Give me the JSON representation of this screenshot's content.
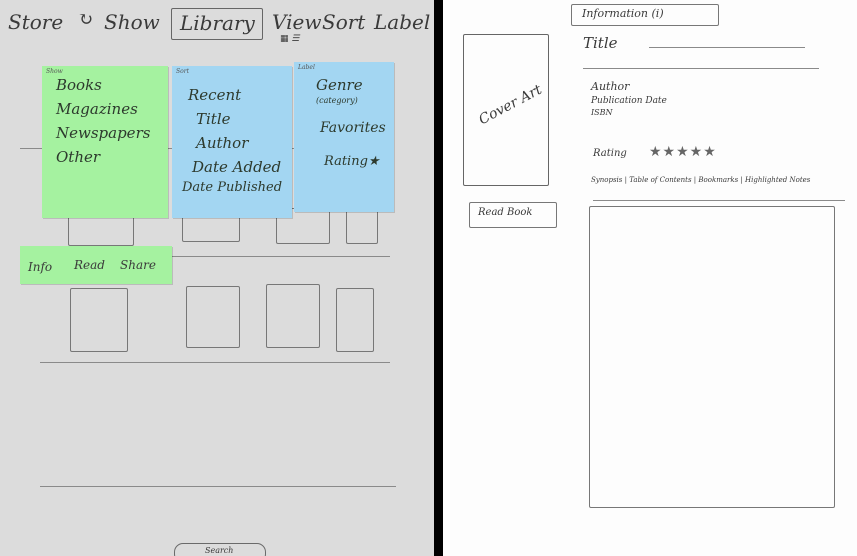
{
  "nav": {
    "store": "Store",
    "sync": "↻",
    "show": "Show",
    "library": "Library",
    "view": "View",
    "view_sub": "▦ ☰",
    "sort": "Sort",
    "label": "Label"
  },
  "show_menu": {
    "tab": "Show",
    "items": [
      "Books",
      "Magazines",
      "Newspapers",
      "Other"
    ]
  },
  "sort_menu": {
    "tab": "Sort",
    "items": [
      "Recent",
      "Title",
      "Author",
      "Date Added",
      "Date Published"
    ]
  },
  "label_menu": {
    "tab": "Label",
    "genre": "Genre",
    "genre_sub": "(category)",
    "favorites": "Favorites",
    "rating": "Rating★"
  },
  "action_bar": {
    "info": "Info",
    "read": "Read",
    "share": "Share"
  },
  "search": "Search",
  "detail": {
    "header": "Information (i)",
    "title": "Title",
    "cover_art": "Cover Art",
    "author": "Author",
    "publication_date": "Publication Date",
    "isbn": "ISBN",
    "rating_label": "Rating",
    "rating_stars": "★★★★★",
    "tabs": [
      "Synopsis",
      "Table of Contents",
      "Bookmarks",
      "Highlighted Notes"
    ],
    "read_book": "Read Book"
  },
  "colors": {
    "green_note": "#a5f2a0",
    "blue_note": "#a3d6f2",
    "paper_left": "#dcdcdc",
    "paper_right": "#fdfdfd"
  }
}
